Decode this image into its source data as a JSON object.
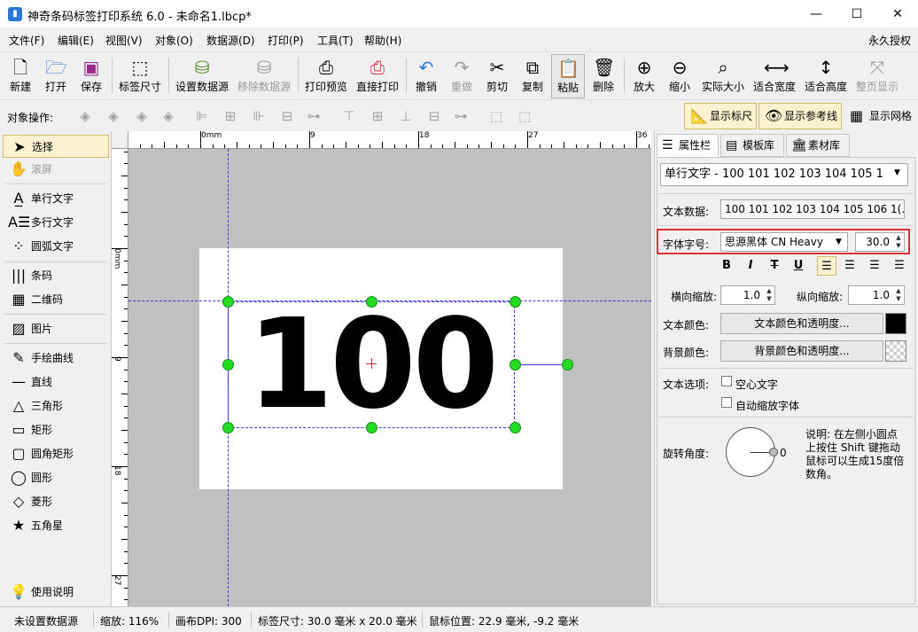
{
  "window": {
    "title": "神奇条码标签打印系统 6.0 - 未命名1.lbcp*",
    "app_icon": "barcode-app-icon",
    "controls": {
      "minimize": "—",
      "maximize": "☐",
      "close": "✕"
    }
  },
  "menu": {
    "items": [
      "文件(F)",
      "编辑(E)",
      "视图(V)",
      "对象(O)",
      "数据源(D)",
      "打印(P)",
      "工具(T)",
      "帮助(H)"
    ],
    "license": "永久授权"
  },
  "toolbar": {
    "new": "新建",
    "open": "打开",
    "save": "保存",
    "label_size": "标签尺寸",
    "set_datasource": "设置数据源",
    "remove_datasource": "移除数据源",
    "print_preview": "打印预览",
    "direct_print": "直接打印",
    "undo": "撤销",
    "redo": "重做",
    "cut": "剪切",
    "copy": "复制",
    "paste": "粘贴",
    "delete": "删除",
    "zoom_in": "放大",
    "zoom_out": "缩小",
    "actual_size": "实际大小",
    "fit_width": "适合宽度",
    "fit_height": "适合高度",
    "full_page": "整页显示"
  },
  "object_bar": {
    "label": "对象操作:",
    "show_ruler": "显示标尺",
    "show_guides": "显示参考线",
    "show_grid": "显示网格"
  },
  "tools": {
    "select": "选择",
    "scroll": "滚屏",
    "single_text": "单行文字",
    "multi_text": "多行文字",
    "arc_text": "圆弧文字",
    "barcode": "条码",
    "qrcode": "二维码",
    "image": "图片",
    "freehand": "手绘曲线",
    "line": "直线",
    "triangle": "三角形",
    "rectangle": "矩形",
    "rounded_rect": "圆角矩形",
    "circle": "圆形",
    "diamond": "菱形",
    "star": "五角星",
    "help": "使用说明"
  },
  "rulers": {
    "h_ticks": [
      "0mm",
      "9",
      "18",
      "27",
      "36"
    ],
    "v_ticks": [
      "0mm",
      "9",
      "18",
      "27"
    ]
  },
  "canvas": {
    "text": "100"
  },
  "right_panel": {
    "tabs": {
      "properties": "属性栏",
      "templates": "模板库",
      "assets": "素材库"
    },
    "object_select": "单行文字 - 100 101 102 103 104 105 1",
    "text_data_label": "文本数据:",
    "text_data_value": "100 101 102 103 104 105 106 1(...",
    "font_label": "字体字号:",
    "font_name": "思源黑体 CN Heavy",
    "font_size": "30.0",
    "format": {
      "bold": "B",
      "italic": "I",
      "strike": "T",
      "underline": "U"
    },
    "hscale_label": "横向缩放:",
    "hscale_value": "1.0",
    "vscale_label": "纵向缩放:",
    "vscale_value": "1.0",
    "text_color_label": "文本颜色:",
    "text_color_btn": "文本颜色和透明度...",
    "text_color": "#000000",
    "bg_color_label": "背景颜色:",
    "bg_color_btn": "背景颜色和透明度...",
    "text_options_label": "文本选项:",
    "hollow_text": "空心文字",
    "auto_shrink": "自动缩放字体",
    "rotation_label": "旋转角度:",
    "rotation_value": "0",
    "rotation_hint": [
      "说明: 在左侧小圆点",
      "上按住 Shift 键拖动",
      "鼠标可以生成15度倍",
      "数角。"
    ]
  },
  "status": {
    "datasource": "未设置数据源",
    "zoom": "缩放: 116%",
    "dpi": "画布DPI: 300",
    "label_size": "标签尺寸: 30.0 毫米 x 20.0 毫米",
    "mouse_pos": "鼠标位置: 22.9 毫米, -9.2 毫米"
  },
  "colors": {
    "accent": "#2a78d6",
    "handle": "#22dd22",
    "guide": "#3a3ae0",
    "selected_tool_bg": "#fdf2cf",
    "highlight_border": "#e0303a"
  }
}
